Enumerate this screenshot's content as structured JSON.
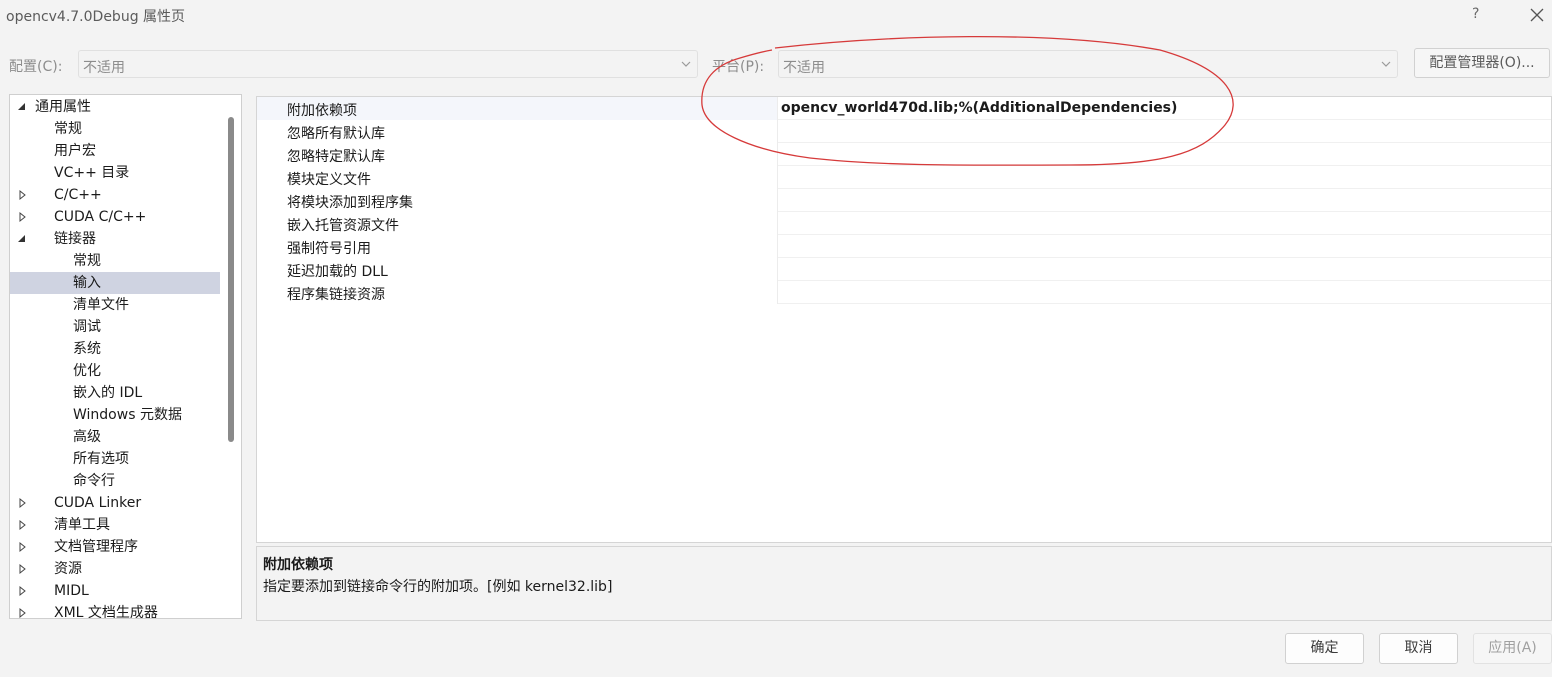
{
  "window": {
    "title": "opencv4.7.0Debug 属性页",
    "help_label": "?"
  },
  "config_bar": {
    "config_label": "配置(C):",
    "config_value": "不适用",
    "platform_label": "平台(P):",
    "platform_value": "不适用",
    "config_manager_button": "配置管理器(O)..."
  },
  "tree": {
    "items": [
      {
        "label": "通用属性",
        "expander": "expanded"
      },
      {
        "label": "常规"
      },
      {
        "label": "用户宏"
      },
      {
        "label": "VC++ 目录"
      },
      {
        "label": "C/C++",
        "expander": "collapsed"
      },
      {
        "label": "CUDA C/C++",
        "expander": "collapsed"
      },
      {
        "label": "链接器",
        "expander": "expanded"
      },
      {
        "label": "常规"
      },
      {
        "label": "输入",
        "selected": true
      },
      {
        "label": "清单文件"
      },
      {
        "label": "调试"
      },
      {
        "label": "系统"
      },
      {
        "label": "优化"
      },
      {
        "label": "嵌入的 IDL"
      },
      {
        "label": "Windows 元数据"
      },
      {
        "label": "高级"
      },
      {
        "label": "所有选项"
      },
      {
        "label": "命令行"
      },
      {
        "label": "CUDA Linker",
        "expander": "collapsed"
      },
      {
        "label": "清单工具",
        "expander": "collapsed"
      },
      {
        "label": "文档管理程序",
        "expander": "collapsed"
      },
      {
        "label": "资源",
        "expander": "collapsed"
      },
      {
        "label": "MIDL",
        "expander": "collapsed"
      },
      {
        "label": "XML 文档生成器",
        "expander": "collapsed"
      }
    ]
  },
  "properties": {
    "rows": [
      {
        "name": "附加依赖项",
        "value": "opencv_world470d.lib;%(AdditionalDependencies)"
      },
      {
        "name": "忽略所有默认库",
        "value": ""
      },
      {
        "name": "忽略特定默认库",
        "value": ""
      },
      {
        "name": "模块定义文件",
        "value": ""
      },
      {
        "name": "将模块添加到程序集",
        "value": ""
      },
      {
        "name": "嵌入托管资源文件",
        "value": ""
      },
      {
        "name": "强制符号引用",
        "value": ""
      },
      {
        "name": "延迟加载的 DLL",
        "value": ""
      },
      {
        "name": "程序集链接资源",
        "value": ""
      }
    ]
  },
  "description": {
    "title": "附加依赖项",
    "text": "指定要添加到链接命令行的附加项。[例如 kernel32.lib]"
  },
  "buttons": {
    "ok": "确定",
    "cancel": "取消",
    "apply": "应用(A)"
  },
  "colors": {
    "annotation": "#d63a3a",
    "selected_item": "#cfd3e1"
  }
}
